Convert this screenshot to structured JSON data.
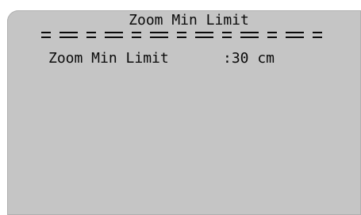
{
  "menu": {
    "title": "Zoom Min Limit",
    "separator_pattern": [
      "short",
      "long",
      "short",
      "long",
      "short",
      "long",
      "short",
      "long",
      "short",
      "long",
      "short",
      "long",
      "short"
    ],
    "rows": [
      {
        "label": "Zoom Min Limit",
        "value": ":30 cm"
      }
    ]
  },
  "colors": {
    "background": "#c5c5c5",
    "text": "#0a0a0a"
  }
}
